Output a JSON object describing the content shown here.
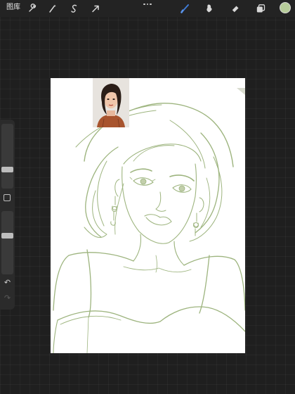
{
  "toolbar": {
    "gallery_label": "图库",
    "tools": [
      {
        "name": "actions-wrench-icon"
      },
      {
        "name": "adjustments-wand-icon"
      },
      {
        "name": "selection-icon"
      },
      {
        "name": "transform-arrow-icon"
      },
      {
        "name": "brush-icon",
        "active": true
      },
      {
        "name": "smudge-icon"
      },
      {
        "name": "eraser-icon"
      },
      {
        "name": "layers-icon"
      }
    ],
    "current_color": "#b7cc9a",
    "active_color": "#3f7bd6"
  },
  "sidebar": {
    "brush_size_slider": {
      "level": 0.27
    },
    "opacity_slider": {
      "level": 0.62
    },
    "undo_icon": "undo-arrow-icon",
    "redo_icon": "redo-arrow-icon"
  },
  "canvas": {
    "background": "#ffffff",
    "sketch_color": "#9db47e",
    "reference_photo": "reference-portrait-thumbnail"
  }
}
